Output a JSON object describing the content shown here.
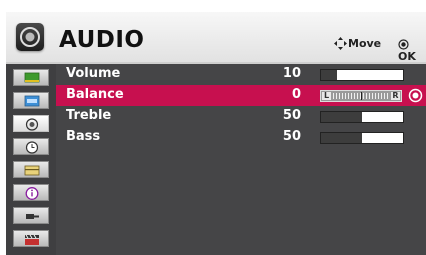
{
  "menu": {
    "title": "AUDIO",
    "icon": "speaker-icon",
    "hints": {
      "move": "Move",
      "ok": "OK"
    }
  },
  "sidebar": {
    "tabs": [
      {
        "name": "picture-tab",
        "icon": "picture-icon"
      },
      {
        "name": "screen-tab",
        "icon": "screen-icon"
      },
      {
        "name": "audio-tab",
        "icon": "speaker-icon",
        "active": true
      },
      {
        "name": "time-tab",
        "icon": "clock-icon"
      },
      {
        "name": "option-tab",
        "icon": "option-icon"
      },
      {
        "name": "info-tab",
        "icon": "info-icon"
      },
      {
        "name": "input-tab",
        "icon": "input-icon"
      },
      {
        "name": "media-tab",
        "icon": "clapperboard-icon"
      }
    ]
  },
  "settings": [
    {
      "label": "Volume",
      "value": "10",
      "level": 0.2
    },
    {
      "label": "Balance",
      "value": "0",
      "selected": true,
      "scale_left": "L",
      "scale_right": "R"
    },
    {
      "label": "Treble",
      "value": "50",
      "level": 0.5
    },
    {
      "label": "Bass",
      "value": "50",
      "level": 0.5
    }
  ],
  "colors": {
    "selection": "#c7104f",
    "panel": "#454547",
    "header": "#eeeeee"
  }
}
